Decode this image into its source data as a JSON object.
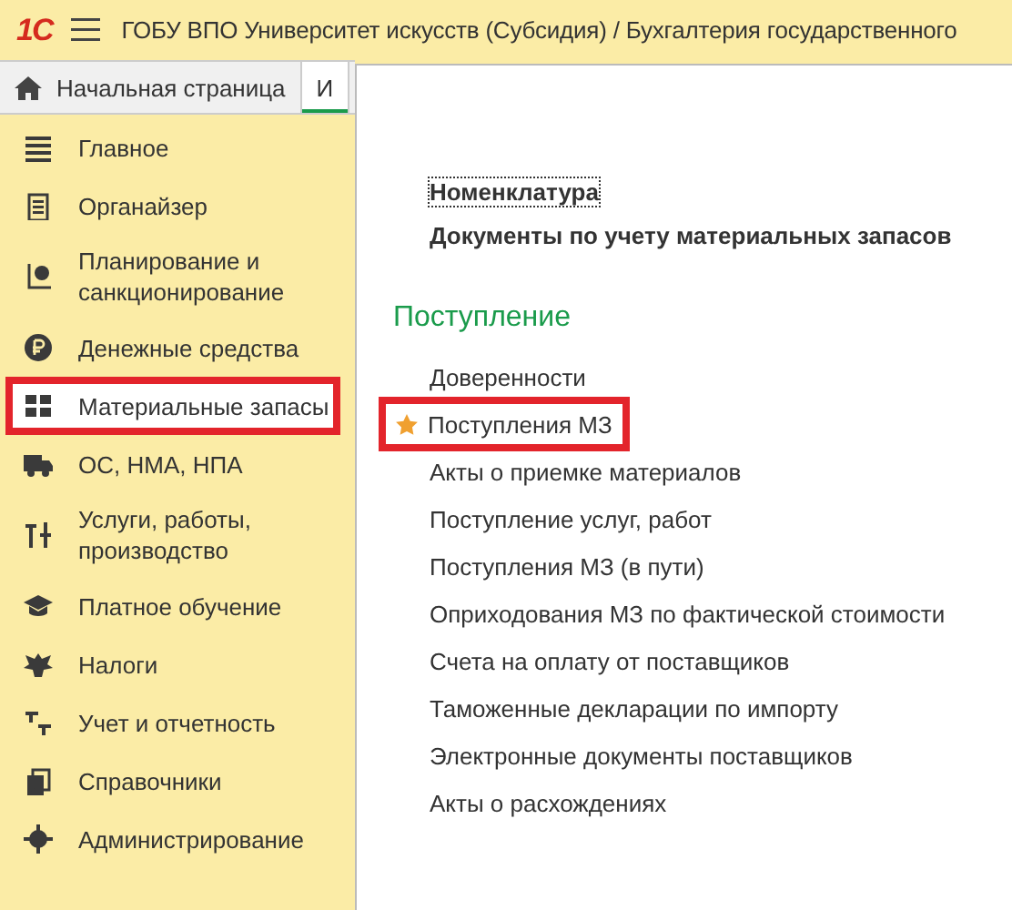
{
  "header": {
    "logo": "1С",
    "title": "ГОБУ ВПО Университет искусств (Субсидия) / Бухгалтерия государственного"
  },
  "tabs": [
    {
      "label": "Начальная страница",
      "kind": "home",
      "selected": false
    },
    {
      "label": "И",
      "kind": "plain",
      "selected": true
    }
  ],
  "sidebar": {
    "items": [
      {
        "label": "Главное",
        "kind": "list",
        "selected": false,
        "highlighted": false
      },
      {
        "label": "Органайзер",
        "kind": "clipboard",
        "selected": false,
        "highlighted": false
      },
      {
        "label": "Планирование и санкционирование",
        "kind": "chart",
        "selected": false,
        "highlighted": false
      },
      {
        "label": "Денежные средства",
        "kind": "coin",
        "selected": false,
        "highlighted": false
      },
      {
        "label": "Материальные запасы",
        "kind": "grid",
        "selected": true,
        "highlighted": true
      },
      {
        "label": "ОС, НМА, НПА",
        "kind": "truck",
        "selected": false,
        "highlighted": false
      },
      {
        "label": "Услуги, работы, производство",
        "kind": "tools",
        "selected": false,
        "highlighted": false
      },
      {
        "label": "Платное обучение",
        "kind": "cap",
        "selected": false,
        "highlighted": false
      },
      {
        "label": "Налоги",
        "kind": "emblem",
        "selected": false,
        "highlighted": false
      },
      {
        "label": "Учет и отчетность",
        "kind": "dtkt",
        "selected": false,
        "highlighted": false
      },
      {
        "label": "Справочники",
        "kind": "books",
        "selected": false,
        "highlighted": false
      },
      {
        "label": "Администрирование",
        "kind": "gear",
        "selected": false,
        "highlighted": false
      }
    ]
  },
  "panel": {
    "top_links": [
      {
        "label": "Номенклатура",
        "focused": true
      },
      {
        "label": "Документы по учету материальных запасов",
        "focused": false
      }
    ],
    "section": {
      "title": "Поступление",
      "items": [
        {
          "label": "Доверенности",
          "favorite": false,
          "highlighted": false
        },
        {
          "label": "Поступления МЗ",
          "favorite": true,
          "highlighted": true
        },
        {
          "label": "Акты о приемке материалов",
          "favorite": false,
          "highlighted": false
        },
        {
          "label": "Поступление услуг, работ",
          "favorite": false,
          "highlighted": false
        },
        {
          "label": "Поступления МЗ (в пути)",
          "favorite": false,
          "highlighted": false
        },
        {
          "label": "Оприходования МЗ по фактической стоимости",
          "favorite": false,
          "highlighted": false
        },
        {
          "label": "Счета на оплату от поставщиков",
          "favorite": false,
          "highlighted": false
        },
        {
          "label": "Таможенные декларации по импорту",
          "favorite": false,
          "highlighted": false
        },
        {
          "label": "Электронные документы поставщиков",
          "favorite": false,
          "highlighted": false
        },
        {
          "label": "Акты о расхождениях",
          "favorite": false,
          "highlighted": false
        }
      ]
    }
  }
}
